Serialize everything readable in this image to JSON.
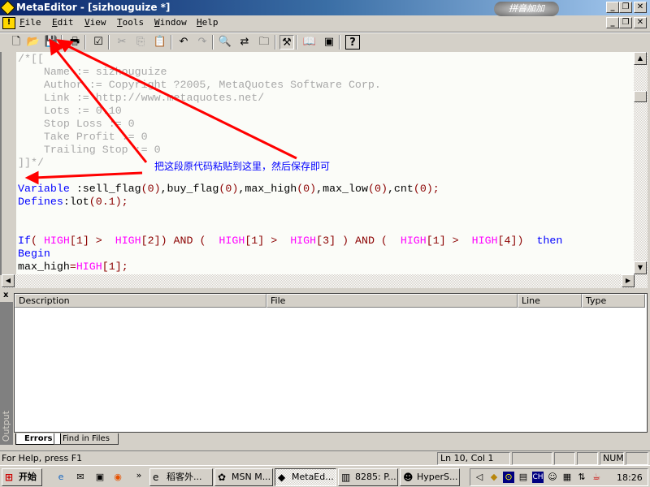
{
  "window": {
    "title": "MetaEditor - [sizhouguize *]",
    "watermark": "拼音加加"
  },
  "menu": [
    {
      "label": "File",
      "key": "F",
      "rest": "ile"
    },
    {
      "label": "Edit",
      "key": "E",
      "rest": "dit"
    },
    {
      "label": "View",
      "key": "V",
      "rest": "iew"
    },
    {
      "label": "Tools",
      "key": "T",
      "rest": "ools"
    },
    {
      "label": "Window",
      "key": "W",
      "rest": "indow"
    },
    {
      "label": "Help",
      "key": "H",
      "rest": "elp"
    }
  ],
  "toolbar": [
    "new-icon",
    "open-icon",
    "save-icon",
    "print-icon",
    "compile-check-icon",
    "cut-icon",
    "copy-icon",
    "paste-icon",
    "undo-icon",
    "redo-icon",
    "find-icon",
    "replace-icon",
    "find-in-files-icon",
    "navigator-icon",
    "dictionary-icon",
    "terminal-icon",
    "help-icon"
  ],
  "editor": {
    "lines": [
      [
        [
          "/*[[",
          "cm"
        ]
      ],
      [
        [
          "    Name := sizhouguize",
          "cm"
        ]
      ],
      [
        [
          "    Author := Copyright ?2005, MetaQuotes Software Corp.",
          "cm"
        ]
      ],
      [
        [
          "    Link := http://www.metaquotes.net/",
          "cm"
        ]
      ],
      [
        [
          "    Lots := 0.10",
          "cm"
        ]
      ],
      [
        [
          "    Stop Loss := 0",
          "cm"
        ]
      ],
      [
        [
          "    Take Profit := 0",
          "cm"
        ]
      ],
      [
        [
          "    Trailing Stop := 0",
          "cm"
        ]
      ],
      [
        [
          "]]*/",
          "cm"
        ]
      ],
      [],
      [
        [
          "Variable ",
          "kw"
        ],
        [
          ":sell_flag",
          "pl"
        ],
        [
          "(0)",
          "pn"
        ],
        [
          ",buy_flag",
          "pl"
        ],
        [
          "(0)",
          "pn"
        ],
        [
          ",max_high",
          "pl"
        ],
        [
          "(0)",
          "pn"
        ],
        [
          ",max_low",
          "pl"
        ],
        [
          "(0)",
          "pn"
        ],
        [
          ",cnt",
          "pl"
        ],
        [
          "(0);",
          "pn"
        ]
      ],
      [
        [
          "Defines",
          "kw"
        ],
        [
          ":lot",
          "pl"
        ],
        [
          "(0.1);",
          "pn"
        ]
      ],
      [],
      [],
      [
        [
          "If",
          "kw"
        ],
        [
          "( ",
          "pn"
        ],
        [
          "HIGH",
          "fn"
        ],
        [
          "[1] >  ",
          "pn"
        ],
        [
          "HIGH",
          "fn"
        ],
        [
          "[2]) AND (  ",
          "pn"
        ],
        [
          "HIGH",
          "fn"
        ],
        [
          "[1] >  ",
          "pn"
        ],
        [
          "HIGH",
          "fn"
        ],
        [
          "[3] ) AND (  ",
          "pn"
        ],
        [
          "HIGH",
          "fn"
        ],
        [
          "[1] >  ",
          "pn"
        ],
        [
          "HIGH",
          "fn"
        ],
        [
          "[4])  ",
          "pn"
        ],
        [
          "then",
          "kw"
        ]
      ],
      [
        [
          "Begin",
          "kw"
        ]
      ],
      [
        [
          "max_high",
          "pl"
        ],
        [
          "=",
          "pn"
        ],
        [
          "HIGH",
          "fn"
        ],
        [
          "[1];",
          "pn"
        ]
      ]
    ]
  },
  "annotation": "把这段原代码粘贴到这里，然后保存即可",
  "output": {
    "label": "Output",
    "columns": [
      "Description",
      "File",
      "Line",
      "Type"
    ],
    "tabs": [
      "Errors",
      "Find in Files"
    ],
    "active_tab": "Errors"
  },
  "status": {
    "help": "For Help, press F1",
    "position": "Ln 10, Col 1",
    "num": "NUM"
  },
  "taskbar": {
    "start": "开始",
    "tasks": [
      "稻客外...",
      "MSN M...",
      "MetaEd...",
      "8285: P...",
      "HyperS..."
    ],
    "active": "MetaEd...",
    "clock": "18:26"
  }
}
